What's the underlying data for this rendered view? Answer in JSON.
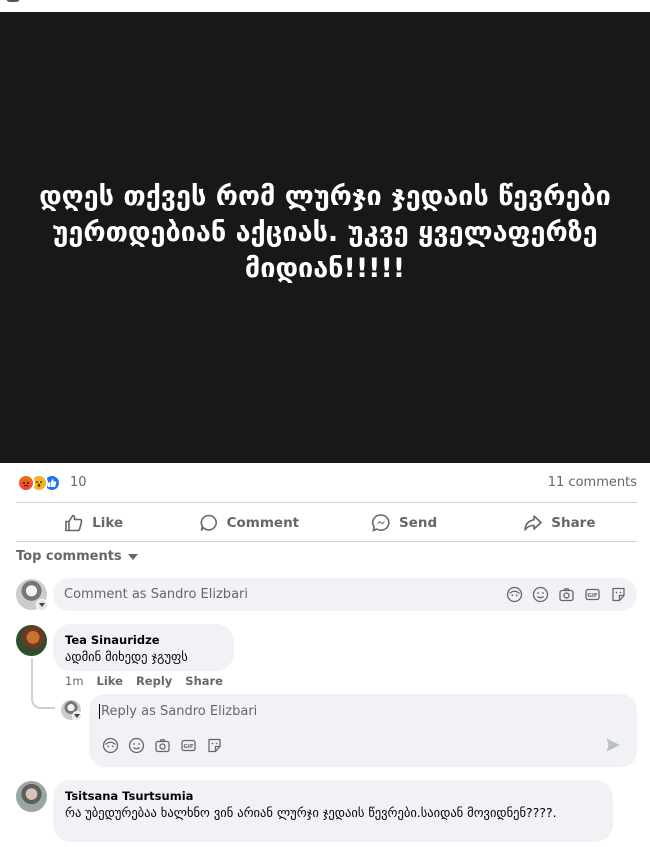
{
  "post": {
    "image_text": "დღეს თქვეს რომ ლურჯი ჯედაის წევრები უერთდებიან აქციას. უკვე ყველაფერზე მიდიან!!!!!"
  },
  "stats": {
    "reaction_icons": [
      "angry-icon",
      "wow-icon",
      "like-icon"
    ],
    "reaction_count": "10",
    "comments_count": "11 comments"
  },
  "actions": {
    "like": "Like",
    "comment": "Comment",
    "send": "Send",
    "share": "Share"
  },
  "sort": {
    "label": "Top comments"
  },
  "composer": {
    "placeholder": "Comment as Sandro Elizbari",
    "icons": [
      "avatar-sticker-icon",
      "emoji-icon",
      "camera-icon",
      "gif-icon",
      "sticker-icon"
    ]
  },
  "comments": [
    {
      "author": "Tea Sinauridze",
      "text": "ადმინ მიხედე ჯგუფს",
      "time": "1m",
      "like": "Like",
      "reply": "Reply",
      "share": "Share"
    },
    {
      "author": "Tsitsana Tsurtsumia",
      "text": "რა უბედურებაა ხალხნო ვინ არიან ლურჯი ჯედაის წევრები.საიდან მოვიდნენ????."
    }
  ],
  "reply_composer": {
    "placeholder": "Reply as Sandro Elizbari"
  },
  "colors": {
    "image_background": "#181818",
    "bubble": "#f0f2f5",
    "secondary_text": "#65676b",
    "like_blue": "#1877f2"
  }
}
